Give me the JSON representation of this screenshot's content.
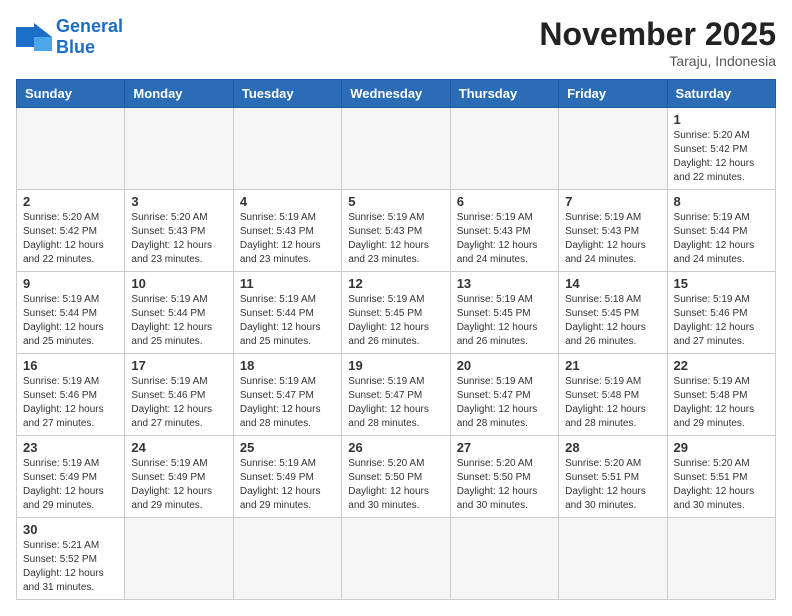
{
  "header": {
    "logo_general": "General",
    "logo_blue": "Blue",
    "month_title": "November 2025",
    "subtitle": "Taraju, Indonesia"
  },
  "weekdays": [
    "Sunday",
    "Monday",
    "Tuesday",
    "Wednesday",
    "Thursday",
    "Friday",
    "Saturday"
  ],
  "weeks": [
    [
      {
        "day": "",
        "info": ""
      },
      {
        "day": "",
        "info": ""
      },
      {
        "day": "",
        "info": ""
      },
      {
        "day": "",
        "info": ""
      },
      {
        "day": "",
        "info": ""
      },
      {
        "day": "",
        "info": ""
      },
      {
        "day": "1",
        "info": "Sunrise: 5:20 AM\nSunset: 5:42 PM\nDaylight: 12 hours and 22 minutes."
      }
    ],
    [
      {
        "day": "2",
        "info": "Sunrise: 5:20 AM\nSunset: 5:42 PM\nDaylight: 12 hours and 22 minutes."
      },
      {
        "day": "3",
        "info": "Sunrise: 5:20 AM\nSunset: 5:43 PM\nDaylight: 12 hours and 23 minutes."
      },
      {
        "day": "4",
        "info": "Sunrise: 5:19 AM\nSunset: 5:43 PM\nDaylight: 12 hours and 23 minutes."
      },
      {
        "day": "5",
        "info": "Sunrise: 5:19 AM\nSunset: 5:43 PM\nDaylight: 12 hours and 23 minutes."
      },
      {
        "day": "6",
        "info": "Sunrise: 5:19 AM\nSunset: 5:43 PM\nDaylight: 12 hours and 24 minutes."
      },
      {
        "day": "7",
        "info": "Sunrise: 5:19 AM\nSunset: 5:43 PM\nDaylight: 12 hours and 24 minutes."
      },
      {
        "day": "8",
        "info": "Sunrise: 5:19 AM\nSunset: 5:44 PM\nDaylight: 12 hours and 24 minutes."
      }
    ],
    [
      {
        "day": "9",
        "info": "Sunrise: 5:19 AM\nSunset: 5:44 PM\nDaylight: 12 hours and 25 minutes."
      },
      {
        "day": "10",
        "info": "Sunrise: 5:19 AM\nSunset: 5:44 PM\nDaylight: 12 hours and 25 minutes."
      },
      {
        "day": "11",
        "info": "Sunrise: 5:19 AM\nSunset: 5:44 PM\nDaylight: 12 hours and 25 minutes."
      },
      {
        "day": "12",
        "info": "Sunrise: 5:19 AM\nSunset: 5:45 PM\nDaylight: 12 hours and 26 minutes."
      },
      {
        "day": "13",
        "info": "Sunrise: 5:19 AM\nSunset: 5:45 PM\nDaylight: 12 hours and 26 minutes."
      },
      {
        "day": "14",
        "info": "Sunrise: 5:18 AM\nSunset: 5:45 PM\nDaylight: 12 hours and 26 minutes."
      },
      {
        "day": "15",
        "info": "Sunrise: 5:19 AM\nSunset: 5:46 PM\nDaylight: 12 hours and 27 minutes."
      }
    ],
    [
      {
        "day": "16",
        "info": "Sunrise: 5:19 AM\nSunset: 5:46 PM\nDaylight: 12 hours and 27 minutes."
      },
      {
        "day": "17",
        "info": "Sunrise: 5:19 AM\nSunset: 5:46 PM\nDaylight: 12 hours and 27 minutes."
      },
      {
        "day": "18",
        "info": "Sunrise: 5:19 AM\nSunset: 5:47 PM\nDaylight: 12 hours and 28 minutes."
      },
      {
        "day": "19",
        "info": "Sunrise: 5:19 AM\nSunset: 5:47 PM\nDaylight: 12 hours and 28 minutes."
      },
      {
        "day": "20",
        "info": "Sunrise: 5:19 AM\nSunset: 5:47 PM\nDaylight: 12 hours and 28 minutes."
      },
      {
        "day": "21",
        "info": "Sunrise: 5:19 AM\nSunset: 5:48 PM\nDaylight: 12 hours and 28 minutes."
      },
      {
        "day": "22",
        "info": "Sunrise: 5:19 AM\nSunset: 5:48 PM\nDaylight: 12 hours and 29 minutes."
      }
    ],
    [
      {
        "day": "23",
        "info": "Sunrise: 5:19 AM\nSunset: 5:49 PM\nDaylight: 12 hours and 29 minutes."
      },
      {
        "day": "24",
        "info": "Sunrise: 5:19 AM\nSunset: 5:49 PM\nDaylight: 12 hours and 29 minutes."
      },
      {
        "day": "25",
        "info": "Sunrise: 5:19 AM\nSunset: 5:49 PM\nDaylight: 12 hours and 29 minutes."
      },
      {
        "day": "26",
        "info": "Sunrise: 5:20 AM\nSunset: 5:50 PM\nDaylight: 12 hours and 30 minutes."
      },
      {
        "day": "27",
        "info": "Sunrise: 5:20 AM\nSunset: 5:50 PM\nDaylight: 12 hours and 30 minutes."
      },
      {
        "day": "28",
        "info": "Sunrise: 5:20 AM\nSunset: 5:51 PM\nDaylight: 12 hours and 30 minutes."
      },
      {
        "day": "29",
        "info": "Sunrise: 5:20 AM\nSunset: 5:51 PM\nDaylight: 12 hours and 30 minutes."
      }
    ],
    [
      {
        "day": "30",
        "info": "Sunrise: 5:21 AM\nSunset: 5:52 PM\nDaylight: 12 hours and 31 minutes."
      },
      {
        "day": "",
        "info": ""
      },
      {
        "day": "",
        "info": ""
      },
      {
        "day": "",
        "info": ""
      },
      {
        "day": "",
        "info": ""
      },
      {
        "day": "",
        "info": ""
      },
      {
        "day": "",
        "info": ""
      }
    ]
  ]
}
